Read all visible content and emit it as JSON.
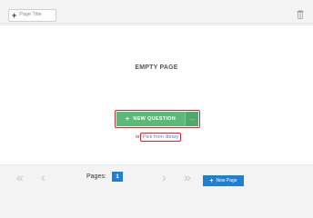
{
  "toolbar": {
    "page_title_button": {
      "icon": "plus-icon",
      "label": "Page Title"
    },
    "trash_icon": "trash-icon"
  },
  "page": {
    "empty_label": "EMPTY PAGE",
    "new_question": {
      "label": "NEW QUESTION",
      "icon": "plus-icon",
      "more_icon": "ellipsis-icon"
    },
    "or_text": "or",
    "library_link": "Pick from library"
  },
  "pager": {
    "first_icon": "double-chevron-left-icon",
    "prev_icon": "chevron-left-icon",
    "pages_label": "Pages:",
    "current_page": "1",
    "next_icon": "chevron-right-icon",
    "last_icon": "double-chevron-right-icon",
    "new_page_label": "New Page"
  },
  "colors": {
    "green": "#5cb979",
    "blue": "#1f7fd3",
    "highlight_red": "#d9232e",
    "link_blue": "#4a86d8"
  }
}
